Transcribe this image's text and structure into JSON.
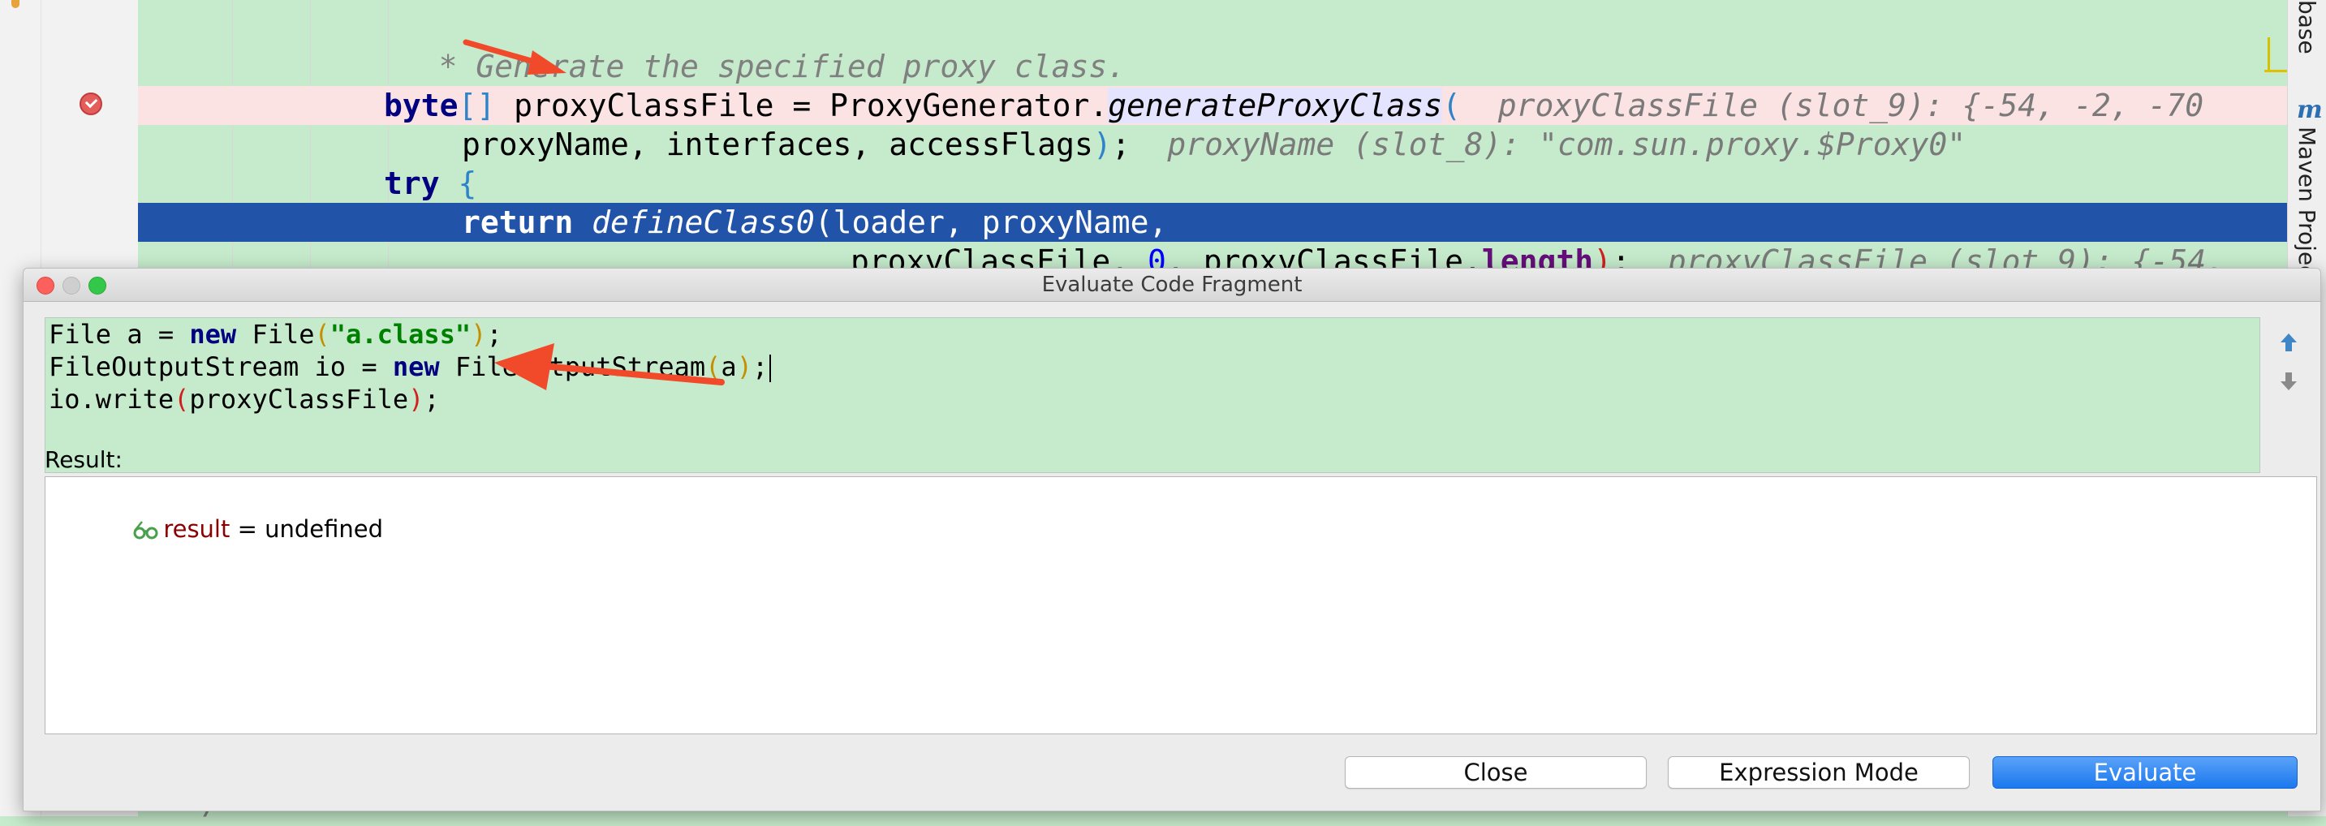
{
  "editor": {
    "comment_line": " * Generate the specified proxy class.",
    "comment_end": " */",
    "bp_line": {
      "kw_byte": "byte",
      "brackets": "[]",
      "decl": " proxyClassFile = ProxyGenerator.",
      "method": "generateProxyClass",
      "paren": "(",
      "inline": "  proxyClassFile (slot_9): {-54, -2, -70"
    },
    "args_line": {
      "args": "proxyName, interfaces, accessFlags",
      "close": ")",
      "semi": ";",
      "inline": "  proxyName (slot_8): \"com.sun.proxy.$Proxy0\""
    },
    "try_line": {
      "kw": "try",
      "brace": " {"
    },
    "return_line": {
      "kw": "return",
      "method": "defineClass0",
      "rest": "(loader, proxyName,"
    },
    "cont_line": {
      "a": "proxyClassFile, ",
      "num": "0",
      "b": ", proxyClassFile.",
      "field": "length",
      "close": ")",
      "semi": ";",
      "inline": "  proxyClassFile (slot_9): {-54,"
    },
    "bottom_fragment": "/**"
  },
  "side_panels": {
    "top_label": "base",
    "maven_label": "Maven Projec",
    "m_glyph": "m"
  },
  "dialog": {
    "title": "Evaluate Code Fragment",
    "code_lines": {
      "l1": {
        "a": "File a = ",
        "kw": "new",
        "b": " File",
        "p1": "(",
        "str": "\"a.class\"",
        "p2": ")",
        "end": ";"
      },
      "l2": {
        "a": "FileOutputStream io = ",
        "kw": "new",
        "b": " FileOutputStream",
        "p1": "(",
        "arg": "a",
        "p2": ")",
        "end": ";"
      },
      "l3": {
        "a": "io.write",
        "p1": "(",
        "arg": "proxyClassFile",
        "p2": ")",
        "end": ";"
      }
    },
    "result_label": "Result:",
    "result": {
      "name": "result",
      "eq": " = ",
      "value": "undefined"
    },
    "buttons": {
      "close": "Close",
      "mode": "Expression Mode",
      "evaluate": "Evaluate"
    }
  },
  "colors": {
    "editor_bg": "#c6ebcc",
    "selection": "#2154a8",
    "breakpoint_line": "#fbe3e4",
    "arrow": "#f04a2a",
    "primary_button": "#1b78ef"
  }
}
